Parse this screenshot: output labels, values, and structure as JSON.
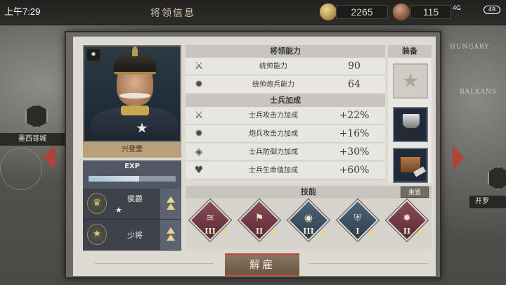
{
  "status": {
    "time": "上午7:29",
    "battery": "49",
    "signal": "4G"
  },
  "topbar": {
    "title": "将领信息",
    "gold": "2265",
    "bronze": "115"
  },
  "map": {
    "labels": [
      "HUNGARY",
      "BALKANS"
    ],
    "left_city": "墨西哥城",
    "right_city": "开罗"
  },
  "general": {
    "name": "兴登堡",
    "exp_label": "EXP",
    "exp_progress": 0.58,
    "ranks": [
      {
        "name": "侯爵",
        "stars": "★"
      },
      {
        "name": "少将",
        "stars": ""
      }
    ]
  },
  "abilities": {
    "title": "将领能力",
    "rows": [
      {
        "icon": "crossed-swords-icon",
        "glyph": "⚔",
        "label": "统帅能力",
        "value": "90"
      },
      {
        "icon": "cannon-icon",
        "glyph": "✹",
        "label": "统帅炮兵能力",
        "value": "64"
      }
    ]
  },
  "soldier_bonus": {
    "title": "士兵加成",
    "rows": [
      {
        "icon": "sword-circle-icon",
        "glyph": "⚔",
        "label": "士兵攻击力加成",
        "value": "+22%"
      },
      {
        "icon": "cannon-circle-icon",
        "glyph": "✹",
        "label": "炮兵攻击力加成",
        "value": "+16%"
      },
      {
        "icon": "shield-circle-icon",
        "glyph": "◈",
        "label": "士兵防御力加成",
        "value": "+30%"
      },
      {
        "icon": "heart-circle-icon",
        "glyph": "♥",
        "label": "士兵生命值加成",
        "value": "+60%"
      }
    ]
  },
  "equipment": {
    "title": "装备"
  },
  "skills": {
    "title": "技能",
    "reset_label": "重置",
    "items": [
      {
        "color": "red",
        "glyph": "≋",
        "level": "III"
      },
      {
        "color": "red",
        "glyph": "⚑",
        "level": "II"
      },
      {
        "color": "blue",
        "glyph": "◉",
        "level": "III"
      },
      {
        "color": "blue",
        "glyph": "⛨",
        "level": "I"
      },
      {
        "color": "red",
        "glyph": "✹",
        "level": "II"
      }
    ]
  },
  "dismiss_label": "解雇"
}
